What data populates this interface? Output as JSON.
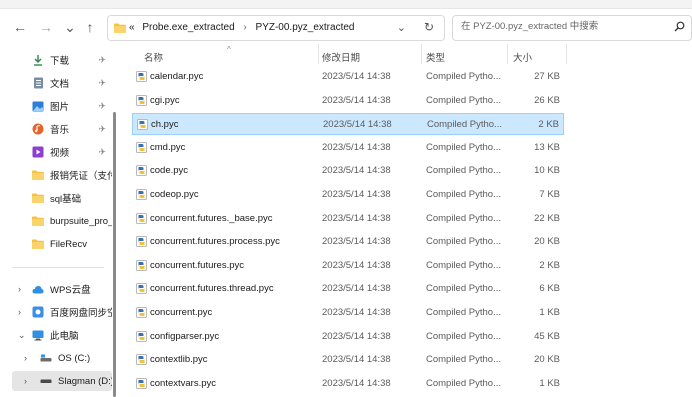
{
  "nav": {
    "back": "←",
    "forward": "→",
    "history": "⌄",
    "up": "↑"
  },
  "address": {
    "prefix": "«",
    "crumbs": [
      "Probe.exe_extracted",
      "PYZ-00.pyz_extracted"
    ],
    "separator": "›",
    "dropdown": "⌄",
    "refresh": "↻"
  },
  "search": {
    "placeholder": "在 PYZ-00.pyz_extracted 中搜索"
  },
  "sidebar": {
    "quick": [
      {
        "label": "下载",
        "icon": "download-icon",
        "pinned": true
      },
      {
        "label": "文档",
        "icon": "document-icon",
        "pinned": true
      },
      {
        "label": "图片",
        "icon": "pictures-icon",
        "pinned": true
      },
      {
        "label": "音乐",
        "icon": "music-icon",
        "pinned": true
      },
      {
        "label": "视频",
        "icon": "video-icon",
        "pinned": true
      },
      {
        "label": "报销凭证（支付",
        "icon": "folder-icon",
        "pinned": false
      },
      {
        "label": "sql基础",
        "icon": "folder-icon",
        "pinned": false
      },
      {
        "label": "burpsuite_pro_",
        "icon": "folder-icon",
        "pinned": false
      },
      {
        "label": "FileRecv",
        "icon": "folder-icon",
        "pinned": false
      }
    ],
    "tree": [
      {
        "label": "WPS云盘",
        "icon": "cloud-icon",
        "chevron": "›"
      },
      {
        "label": "百度网盘同步空",
        "icon": "baidu-sync-icon",
        "chevron": "›"
      },
      {
        "label": "此电脑",
        "icon": "computer-icon",
        "chevron": "⌄"
      },
      {
        "label": "OS (C:)",
        "icon": "drive-icon",
        "chevron": "›"
      },
      {
        "label": "Slagman (D:)",
        "icon": "drive-icon",
        "chevron": "›"
      }
    ],
    "pin_glyph": "✈"
  },
  "columns": {
    "name": "名称",
    "date": "修改日期",
    "type": "类型",
    "size": "大小",
    "sort_indicator": "^"
  },
  "files": [
    {
      "name": "calendar.pyc",
      "date": "2023/5/14 14:38",
      "type": "Compiled Pytho...",
      "size": "27 KB"
    },
    {
      "name": "cgi.pyc",
      "date": "2023/5/14 14:38",
      "type": "Compiled Pytho...",
      "size": "26 KB"
    },
    {
      "name": "ch.pyc",
      "date": "2023/5/14 14:38",
      "type": "Compiled Pytho...",
      "size": "2 KB",
      "selected": true
    },
    {
      "name": "cmd.pyc",
      "date": "2023/5/14 14:38",
      "type": "Compiled Pytho...",
      "size": "13 KB"
    },
    {
      "name": "code.pyc",
      "date": "2023/5/14 14:38",
      "type": "Compiled Pytho...",
      "size": "10 KB"
    },
    {
      "name": "codeop.pyc",
      "date": "2023/5/14 14:38",
      "type": "Compiled Pytho...",
      "size": "7 KB"
    },
    {
      "name": "concurrent.futures._base.pyc",
      "date": "2023/5/14 14:38",
      "type": "Compiled Pytho...",
      "size": "22 KB"
    },
    {
      "name": "concurrent.futures.process.pyc",
      "date": "2023/5/14 14:38",
      "type": "Compiled Pytho...",
      "size": "20 KB"
    },
    {
      "name": "concurrent.futures.pyc",
      "date": "2023/5/14 14:38",
      "type": "Compiled Pytho...",
      "size": "2 KB"
    },
    {
      "name": "concurrent.futures.thread.pyc",
      "date": "2023/5/14 14:38",
      "type": "Compiled Pytho...",
      "size": "6 KB"
    },
    {
      "name": "concurrent.pyc",
      "date": "2023/5/14 14:38",
      "type": "Compiled Pytho...",
      "size": "1 KB"
    },
    {
      "name": "configparser.pyc",
      "date": "2023/5/14 14:38",
      "type": "Compiled Pytho...",
      "size": "45 KB"
    },
    {
      "name": "contextlib.pyc",
      "date": "2023/5/14 14:38",
      "type": "Compiled Pytho...",
      "size": "20 KB"
    },
    {
      "name": "contextvars.pyc",
      "date": "2023/5/14 14:38",
      "type": "Compiled Pytho...",
      "size": "1 KB"
    }
  ],
  "colors": {
    "selection_bg": "#cce8ff",
    "selection_border": "#99d1ff",
    "folder": "#f5c242",
    "accent": "#0067c0"
  }
}
